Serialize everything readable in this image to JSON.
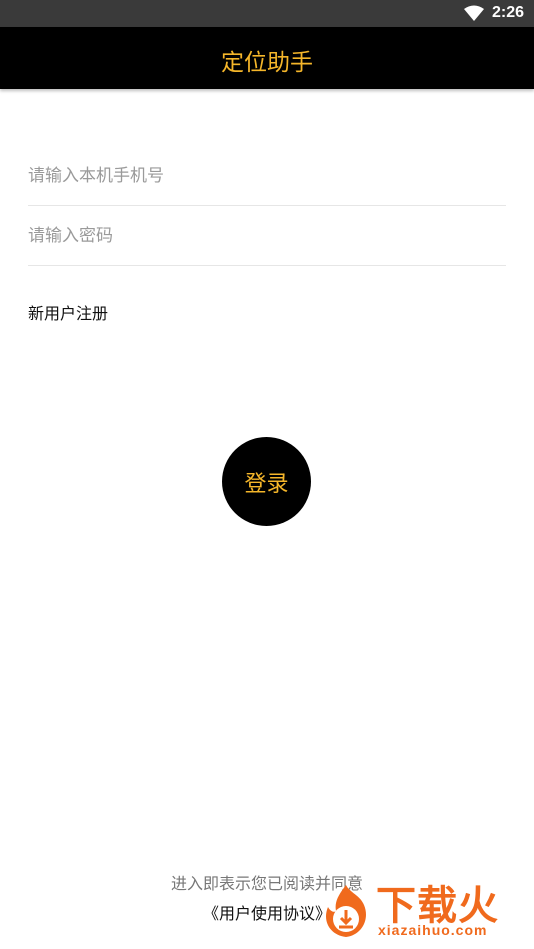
{
  "status_bar": {
    "time": "2:26",
    "icons": [
      "wifi-icon"
    ]
  },
  "app_bar": {
    "title": "定位助手"
  },
  "login_form": {
    "phone_placeholder": "请输入本机手机号",
    "phone_value": "",
    "password_placeholder": "请输入密码",
    "password_value": "",
    "register_label": "新用户注册",
    "login_label": "登录"
  },
  "footer": {
    "agreement_text": "进入即表示您已阅读并同意",
    "agreement_link": "《用户使用协议》"
  },
  "watermark": {
    "name": "下载火",
    "domain": "xiazaihuo.com",
    "icon": "flame-download-icon"
  },
  "colors": {
    "accent": "#f5b62a",
    "app_bar": "#000000",
    "status_bar": "#3a3a3a",
    "watermark": "#f06a1d"
  }
}
